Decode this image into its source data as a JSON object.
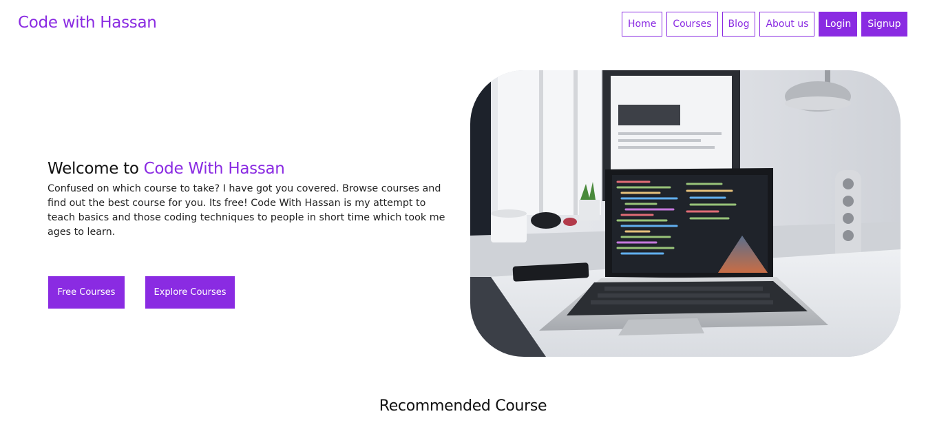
{
  "header": {
    "logo": "Code with Hassan",
    "nav": [
      "Home",
      "Courses",
      "Blog",
      "About us"
    ],
    "login": "Login",
    "signup": "Signup"
  },
  "hero": {
    "title_prefix": "Welcome to",
    "title_brand": "Code With Hassan",
    "description": "Confused on which course to take? I have got you covered. Browse courses and find out the best course for you. Its free! Code With Hassan is my attempt to teach basics and those coding techniques to people in short time which took me ages to learn.",
    "free_courses": "Free Courses",
    "explore_courses": "Explore Courses",
    "image_name": "laptop-desk-photo"
  },
  "recommended": {
    "title": "Recommended Course"
  },
  "colors": {
    "accent": "#8a2be2",
    "text": "#111111",
    "background": "#ffffff"
  }
}
